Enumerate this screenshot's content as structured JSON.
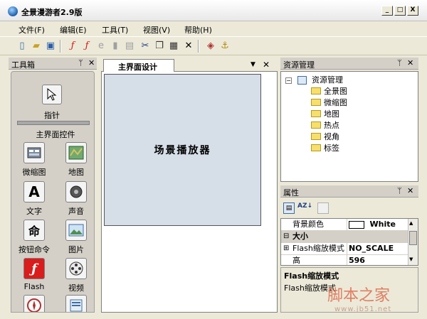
{
  "app": {
    "title": "全景漫游者2.9版"
  },
  "window_controls": {
    "minimize": "_",
    "maximize": "□",
    "close": "X"
  },
  "menu": [
    "文件(F)",
    "编辑(E)",
    "工具(T)",
    "视图(V)",
    "帮助(H)"
  ],
  "toolbar_icons": [
    "new-file-icon",
    "open-folder-icon",
    "save-icon",
    "flash-icon",
    "flash-alt-icon",
    "ie-icon",
    "disabled-icon",
    "print-icon",
    "cut-icon",
    "copy-icon",
    "paste-icon",
    "delete-icon",
    "book-icon",
    "anchor-icon"
  ],
  "toolbox": {
    "title": "工具箱",
    "pin": "ᛘ",
    "close": "✕",
    "pointer_label": "指针",
    "section_label": "主界面控件",
    "tools": [
      {
        "label": "微缩图",
        "icon": "thumbnail-icon"
      },
      {
        "label": "地图",
        "icon": "map-icon"
      },
      {
        "label": "文字",
        "icon": "text-icon"
      },
      {
        "label": "声音",
        "icon": "sound-icon"
      },
      {
        "label": "按钮命令",
        "icon": "command-icon"
      },
      {
        "label": "图片",
        "icon": "picture-icon"
      },
      {
        "label": "Flash",
        "icon": "flash-icon"
      },
      {
        "label": "视频",
        "icon": "video-icon"
      }
    ],
    "text_glyph": "A",
    "command_glyph": "命"
  },
  "editor": {
    "tab_label": "主界面设计",
    "tab_menu": "▼",
    "tab_close": "✕",
    "stage_label": "场景播放器"
  },
  "resources": {
    "title": "资源管理",
    "pin": "ᛘ",
    "close": "✕",
    "root": "资源管理",
    "items": [
      "全景图",
      "微缩图",
      "地图",
      "热点",
      "视角",
      "标签"
    ]
  },
  "properties": {
    "title": "属性",
    "pin": "ᛘ",
    "close": "✕",
    "rows": [
      {
        "name": "背景颜色",
        "value": "White"
      },
      {
        "name": "大小",
        "value": ""
      },
      {
        "name": "Flash缩放模式",
        "value": "NO_SCALE"
      },
      {
        "name": "高",
        "value": "596"
      }
    ],
    "desc_title": "Flash缩放模式",
    "desc_text": "Flash缩放模式"
  },
  "watermark": {
    "text": "脚本之家",
    "url": "www.jb51.net"
  }
}
